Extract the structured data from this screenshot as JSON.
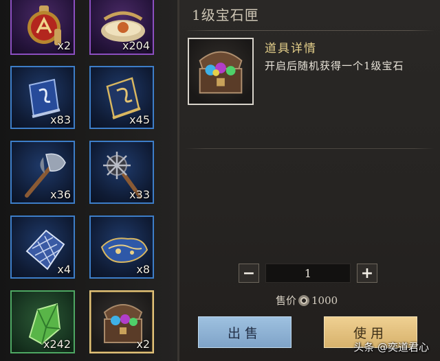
{
  "inventory": {
    "items": [
      {
        "icon": "red-medallion-icon",
        "rarity": "purple",
        "count": "x2"
      },
      {
        "icon": "gold-ornament-icon",
        "rarity": "purple",
        "count": "x204"
      },
      {
        "icon": "blue-scroll-icon",
        "rarity": "blue",
        "count": "x83"
      },
      {
        "icon": "gold-scroll-icon",
        "rarity": "blue",
        "count": "x45"
      },
      {
        "icon": "battle-axe-icon",
        "rarity": "blue",
        "count": "x36"
      },
      {
        "icon": "spiked-mace-icon",
        "rarity": "blue",
        "count": "x33"
      },
      {
        "icon": "crystal-ore-icon",
        "rarity": "blue",
        "count": "x4"
      },
      {
        "icon": "blue-cloth-icon",
        "rarity": "blue",
        "count": "x8"
      },
      {
        "icon": "green-jade-icon",
        "rarity": "green",
        "count": "x242"
      },
      {
        "icon": "gem-chest-icon",
        "rarity": "selected",
        "count": "x2"
      }
    ]
  },
  "detail": {
    "title": "1级宝石匣",
    "heading": "道具详情",
    "description": "开启后随机获得一个1级宝石",
    "quantity": "1",
    "price_label": "售价",
    "price_value": "1000",
    "sell_label": "出售",
    "use_label": "使用"
  },
  "watermark": "头条 @奕道君心",
  "colors": {
    "blue_border": "#3d7ec9",
    "purple_border": "#8c4fc1",
    "green_border": "#4ea863",
    "selected_border": "#e2c37a",
    "sell_button": "#8fb2d6",
    "use_button": "#e3c07f"
  }
}
